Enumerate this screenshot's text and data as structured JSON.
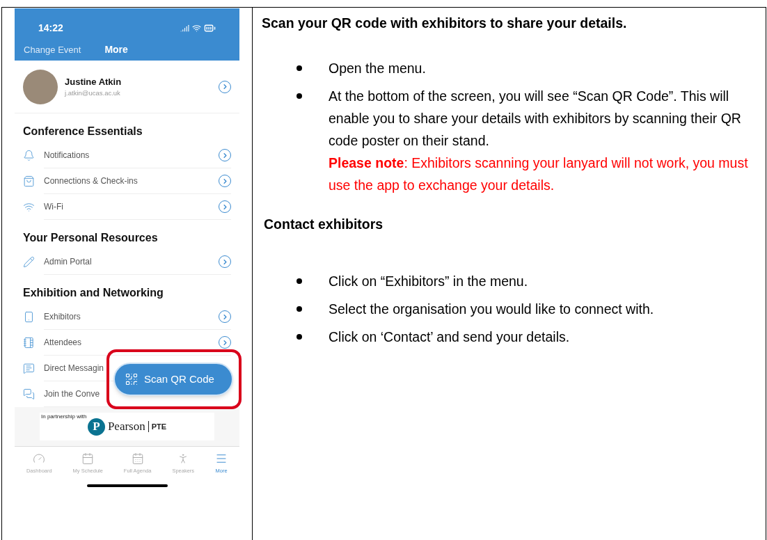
{
  "phone": {
    "status_bar": {
      "time": "14:22"
    },
    "nav": {
      "back": "Change Event",
      "title": "More"
    },
    "profile": {
      "name": "Justine Atkin",
      "email": "j.atkin@ucas.ac.uk"
    },
    "sections": [
      {
        "heading": "Conference Essentials",
        "items": [
          {
            "label": "Notifications",
            "chevron": true
          },
          {
            "label": "Connections & Check-ins",
            "chevron": true
          },
          {
            "label": "Wi-Fi",
            "chevron": true
          }
        ]
      },
      {
        "heading": "Your Personal Resources",
        "items": [
          {
            "label": "Admin Portal",
            "chevron": true
          }
        ]
      },
      {
        "heading": "Exhibition and Networking",
        "items": [
          {
            "label": "Exhibitors",
            "chevron": true
          },
          {
            "label": "Attendees",
            "chevron": true
          },
          {
            "label": "Direct Messagin",
            "chevron": false
          },
          {
            "label": "Join the Conve",
            "chevron": false
          }
        ]
      }
    ],
    "floating_button": {
      "label": "Scan QR Code",
      "highlighted": true
    },
    "partner_banner": {
      "caption": "In partnership with",
      "logo_mark": "P",
      "brand": "Pearson",
      "product": "PTE"
    },
    "tab_bar": [
      {
        "label": "Dashboard",
        "selected": false
      },
      {
        "label": "My Schedule",
        "selected": false
      },
      {
        "label": "Full Agenda",
        "selected": false
      },
      {
        "label": "Speakers",
        "selected": false
      },
      {
        "label": "More",
        "selected": true
      }
    ]
  },
  "instructions": [
    {
      "heading": "Scan your QR code with exhibitors to share your details.",
      "bullets": [
        {
          "text": "Open the menu."
        },
        {
          "text": "At the bottom of the screen, you will see “Scan QR Code”. This will enable you to share your details with exhibitors by scanning their QR code poster on their stand.",
          "note": "**Please note**: Exhibitors scanning your lanyard will not work, you must use the app to exchange your details."
        }
      ]
    },
    {
      "heading": "Contact exhibitors",
      "bullets": [
        {
          "text": "Click on “Exhibitors” in the menu."
        },
        {
          "text": "Select the organisation you would like to connect with."
        },
        {
          "text": "Click on ‘Contact’ and send your details."
        }
      ]
    }
  ]
}
